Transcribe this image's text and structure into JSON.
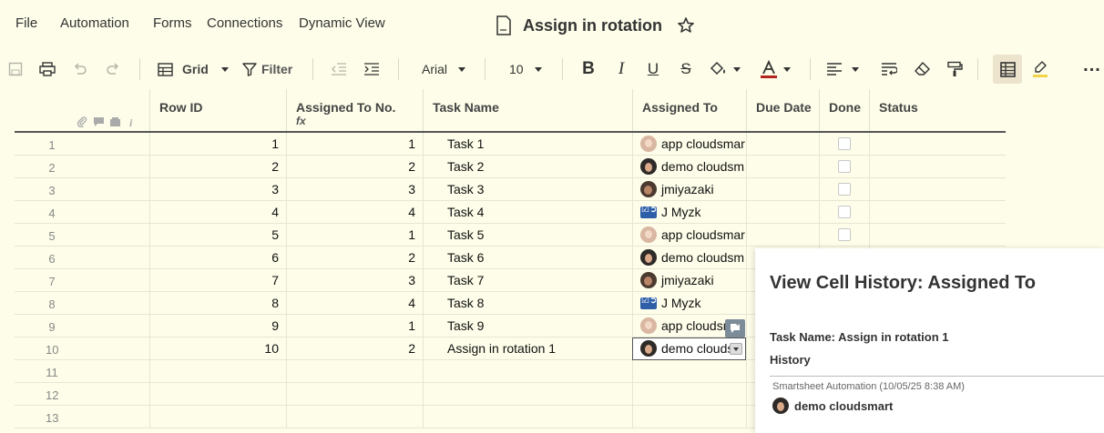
{
  "menu": {
    "items": [
      "File",
      "Automation",
      "Forms",
      "Connections",
      "Dynamic View"
    ],
    "sheet_title": "Assign in rotation"
  },
  "toolbar": {
    "view_label": "Grid",
    "filter_label": "Filter",
    "font_family": "Arial",
    "font_size": "10"
  },
  "grid": {
    "columns": [
      "Row ID",
      "Assigned To No.",
      "Task Name",
      "Assigned To",
      "Due Date",
      "Done",
      "Status"
    ],
    "formula_marker": "fx",
    "rows": [
      {
        "num": "1",
        "id": "1",
        "no": "1",
        "task": "Task 1",
        "assigned": "app cloudsmar",
        "avatar": "female",
        "done": false
      },
      {
        "num": "2",
        "id": "2",
        "no": "2",
        "task": "Task 2",
        "assigned": "demo cloudsm",
        "avatar": "male",
        "done": false
      },
      {
        "num": "3",
        "id": "3",
        "no": "3",
        "task": "Task 3",
        "assigned": "jmiyazaki",
        "avatar": "jm",
        "done": false
      },
      {
        "num": "4",
        "id": "4",
        "no": "4",
        "task": "Task 4",
        "assigned": "J Myzk",
        "avatar": "group",
        "done": false
      },
      {
        "num": "5",
        "id": "5",
        "no": "1",
        "task": "Task 5",
        "assigned": "app cloudsmar",
        "avatar": "female",
        "done": false
      },
      {
        "num": "6",
        "id": "6",
        "no": "2",
        "task": "Task 6",
        "assigned": "demo cloudsm",
        "avatar": "male",
        "done": false
      },
      {
        "num": "7",
        "id": "7",
        "no": "3",
        "task": "Task 7",
        "assigned": "jmiyazaki",
        "avatar": "jm",
        "done": false
      },
      {
        "num": "8",
        "id": "8",
        "no": "4",
        "task": "Task 8",
        "assigned": "J Myzk",
        "avatar": "group",
        "done": false
      },
      {
        "num": "9",
        "id": "9",
        "no": "1",
        "task": "Task 9",
        "assigned": "app cloudsmar",
        "avatar": "female",
        "done": false
      },
      {
        "num": "10",
        "id": "10",
        "no": "2",
        "task": "Assign in rotation 1",
        "assigned": "demo clouds",
        "avatar": "male",
        "done": null
      },
      {
        "num": "11"
      },
      {
        "num": "12"
      },
      {
        "num": "13"
      }
    ]
  },
  "history_panel": {
    "title": "View Cell History: Assigned To",
    "task_line": "Task Name: Assign in rotation 1",
    "history_label": "History",
    "source": "Smartsheet Automation (10/05/25 8:38 AM)",
    "value": "demo cloudsmart"
  },
  "colors": {
    "background": "#fdfde9",
    "panel": "#ffffff",
    "accent": "#ece4cc"
  }
}
